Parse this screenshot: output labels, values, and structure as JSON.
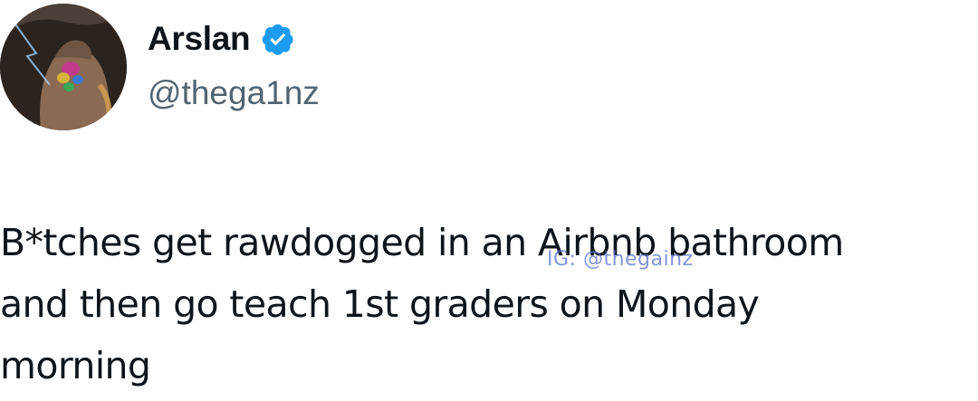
{
  "author": {
    "display_name": "Arslan",
    "handle": "@thega1nz",
    "verified_icon": "verified-badge-icon",
    "verified_color": "#1d9bf0"
  },
  "tweet": {
    "lines": [
      "B*tches get rawdogged in an Airbnb bathroom",
      "and then go teach 1st graders on Monday",
      "morning"
    ]
  },
  "watermark": {
    "text": "IG: @thegainz"
  },
  "colors": {
    "text": "#0f1419",
    "handle": "#536471",
    "watermark": "#5a6fd0"
  }
}
